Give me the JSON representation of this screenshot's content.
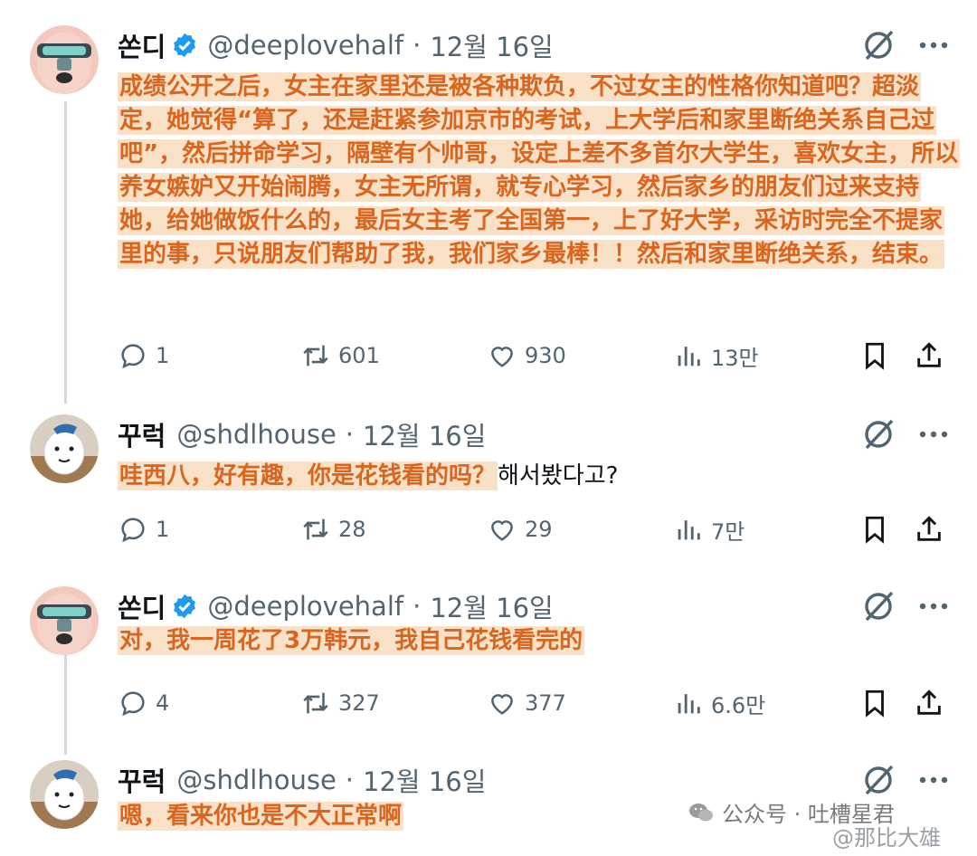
{
  "tweets": [
    {
      "name": "쏜디",
      "handle": "@deeplovehalf",
      "date": "12월 16일",
      "text": "成绩公开之后，女主在家里还是被各种欺负，不过女主的性格你知道吧？超淡定，她觉得“算了，还是赶紧参加京市的考试，上大学后和家里断绝关系自己过吧”，然后拼命学习，隔壁有个帅哥，设定上差不多首尔大学生，喜欢女主，所以养女嫉妒又开始闹腾，女主无所谓，就专心学习，然后家乡的朋友们过来支持她，给她做饭什么的，最后女主考了全国第一，上了好大学，采访时完全不提家里的事，只说朋友们帮助了我，我们家乡最棒！！然后和家里断绝关系，结束。",
      "replies": "1",
      "retweets": "601",
      "likes": "930",
      "views": "13만"
    },
    {
      "name": "꾸럭",
      "handle": "@shdlhouse",
      "date": "12월 16일",
      "text": "哇西八，好有趣，你是花钱看的吗？",
      "text_tail": "해서봤다고?",
      "replies": "1",
      "retweets": "28",
      "likes": "29",
      "views": "7만"
    },
    {
      "name": "쏜디",
      "handle": "@deeplovehalf",
      "date": "12월 16일",
      "text": "对，我一周花了3万韩元，我自己花钱看完的",
      "replies": "4",
      "retweets": "327",
      "likes": "377",
      "views": "6.6만"
    },
    {
      "name": "꾸럭",
      "handle": "@shdlhouse",
      "date": "12월 16일",
      "text": "嗯，看来你也是不大正常啊"
    }
  ],
  "watermark": {
    "wechat": "公众号 · 吐槽星君",
    "weibo": "@那比大雄"
  },
  "colors": {
    "accent_overlay_text": "#d9651f",
    "overlay_background": "#f6d8b6",
    "verified": "#1d9bf0",
    "muted": "#536471"
  }
}
